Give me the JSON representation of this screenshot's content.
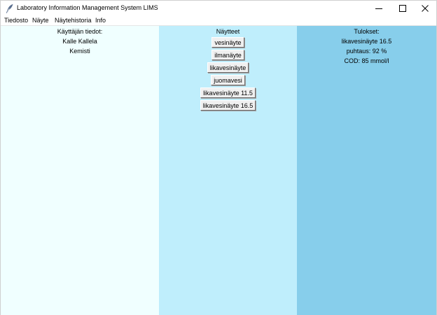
{
  "window": {
    "title": "Laboratory Information Management System LIMS",
    "app_icon": "feather-icon",
    "controls": {
      "minimize_icon": "minimize-icon",
      "maximize_icon": "maximize-icon",
      "close_icon": "close-icon"
    }
  },
  "menu": {
    "items": [
      {
        "label": "Tiedosto"
      },
      {
        "label": "Näyte"
      },
      {
        "label": "Näytehistoria"
      },
      {
        "label": "Info"
      }
    ]
  },
  "user_panel": {
    "heading": "Käyttäjän tiedot:",
    "name": "Kalle Kallela",
    "role": "Kemisti",
    "background": "#f0ffff"
  },
  "samples_panel": {
    "heading": "Näytteet",
    "background": "#bfeefc",
    "buttons": [
      {
        "label": "vesinäyte"
      },
      {
        "label": "ilmanäyte"
      },
      {
        "label": "likavesinäyte"
      },
      {
        "label": "juomavesi"
      },
      {
        "label": "likavesinäyte 11.5"
      },
      {
        "label": "likavesinäyte 16.5"
      }
    ]
  },
  "results_panel": {
    "heading": "Tulokset:",
    "background": "#87ceeb",
    "lines": [
      {
        "text": "likavesinäyte 16.5"
      },
      {
        "text": "puhtaus: 92 %"
      },
      {
        "text": "COD: 85 mmol/l"
      }
    ]
  }
}
